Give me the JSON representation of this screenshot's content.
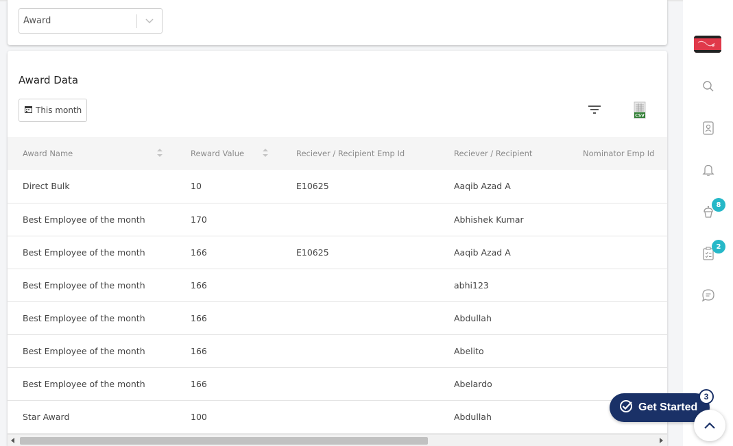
{
  "filter_select": {
    "value": "Award"
  },
  "award_section": {
    "title": "Award Data",
    "date_range_label": "This month"
  },
  "table": {
    "columns": [
      {
        "label": "Award Name",
        "sortable": true
      },
      {
        "label": "Reward Value",
        "sortable": true
      },
      {
        "label": "Reciever / Recipient Emp Id",
        "sortable": false
      },
      {
        "label": "Reciever / Recipient",
        "sortable": false
      },
      {
        "label": "Nominator Emp Id",
        "sortable": false
      }
    ],
    "rows": [
      [
        "Direct Bulk",
        "10",
        "E10625",
        "Aaqib Azad A",
        ""
      ],
      [
        "Best Employee of the month",
        "170",
        "",
        "Abhishek Kumar",
        ""
      ],
      [
        "Best Employee of the month",
        "166",
        "E10625",
        "Aaqib Azad A",
        ""
      ],
      [
        "Best Employee of the month",
        "166",
        "",
        "abhi123",
        ""
      ],
      [
        "Best Employee of the month",
        "166",
        "",
        "Abdullah",
        ""
      ],
      [
        "Best Employee of the month",
        "166",
        "",
        "Abelito",
        ""
      ],
      [
        "Best Employee of the month",
        "166",
        "",
        "Abelardo",
        ""
      ],
      [
        "Star Award",
        "100",
        "",
        "Abdullah",
        ""
      ]
    ]
  },
  "rail": {
    "icons": [
      "search-icon",
      "contact-card-icon",
      "bell-icon",
      "cupcake-icon",
      "clipboard-checklist-icon",
      "chat-icon"
    ],
    "cupcake_badge": "8",
    "clipboard_badge": "2"
  },
  "get_started": {
    "label": "Get Started",
    "badge": "3"
  },
  "colors": {
    "accent": "#1a3167",
    "badge": "#26b8c8",
    "csv_green": "#2e7d32"
  }
}
